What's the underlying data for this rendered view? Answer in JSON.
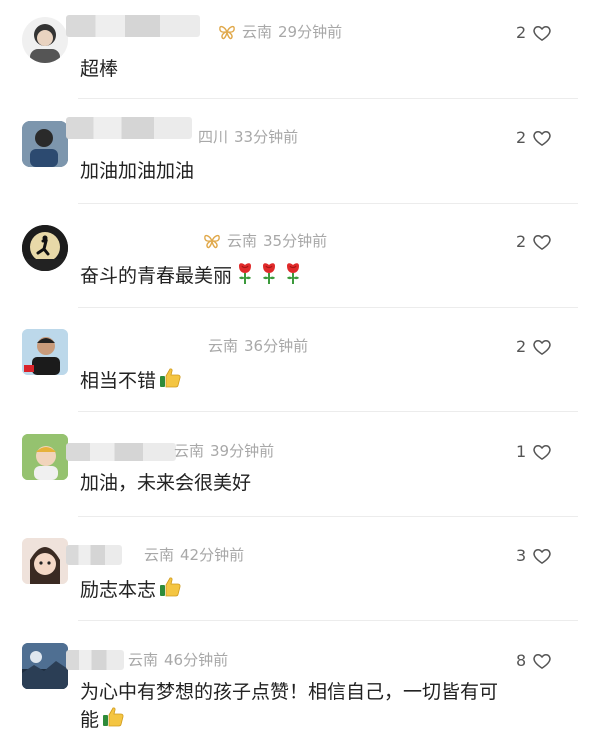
{
  "comments": [
    {
      "text": "超棒",
      "location": "云南",
      "time": "29分钟前",
      "likes": "2",
      "badge": "butterfly-icon"
    },
    {
      "text": "加油加油加油",
      "location": "四川",
      "time": "33分钟前",
      "likes": "2",
      "badge": ""
    },
    {
      "text": "奋斗的青春最美丽",
      "location": "云南",
      "time": "35分钟前",
      "likes": "2",
      "badge": "butterfly-icon",
      "emojis": [
        "rose-icon",
        "rose-icon",
        "rose-icon"
      ]
    },
    {
      "text": "相当不错",
      "location": "云南",
      "time": "36分钟前",
      "likes": "2",
      "badge": "",
      "emojis": [
        "thumbs-up-icon"
      ]
    },
    {
      "text": "加油，未来会很美好",
      "location": "云南",
      "time": "39分钟前",
      "likes": "1",
      "badge": ""
    },
    {
      "text": "励志本志",
      "location": "云南",
      "time": "42分钟前",
      "likes": "3",
      "badge": "",
      "emojis": [
        "thumbs-up-icon"
      ]
    },
    {
      "text_line1": "为心中有梦想的孩子点赞！相信自己，一切皆有可",
      "text_line2": "能",
      "location": "云南",
      "time": "46分钟前",
      "likes": "8",
      "badge": "",
      "emojis": [
        "thumbs-up-icon"
      ]
    }
  ],
  "colors": {
    "meta": "#a8a8a8",
    "badge": "#e0a84a",
    "text": "#222222"
  }
}
